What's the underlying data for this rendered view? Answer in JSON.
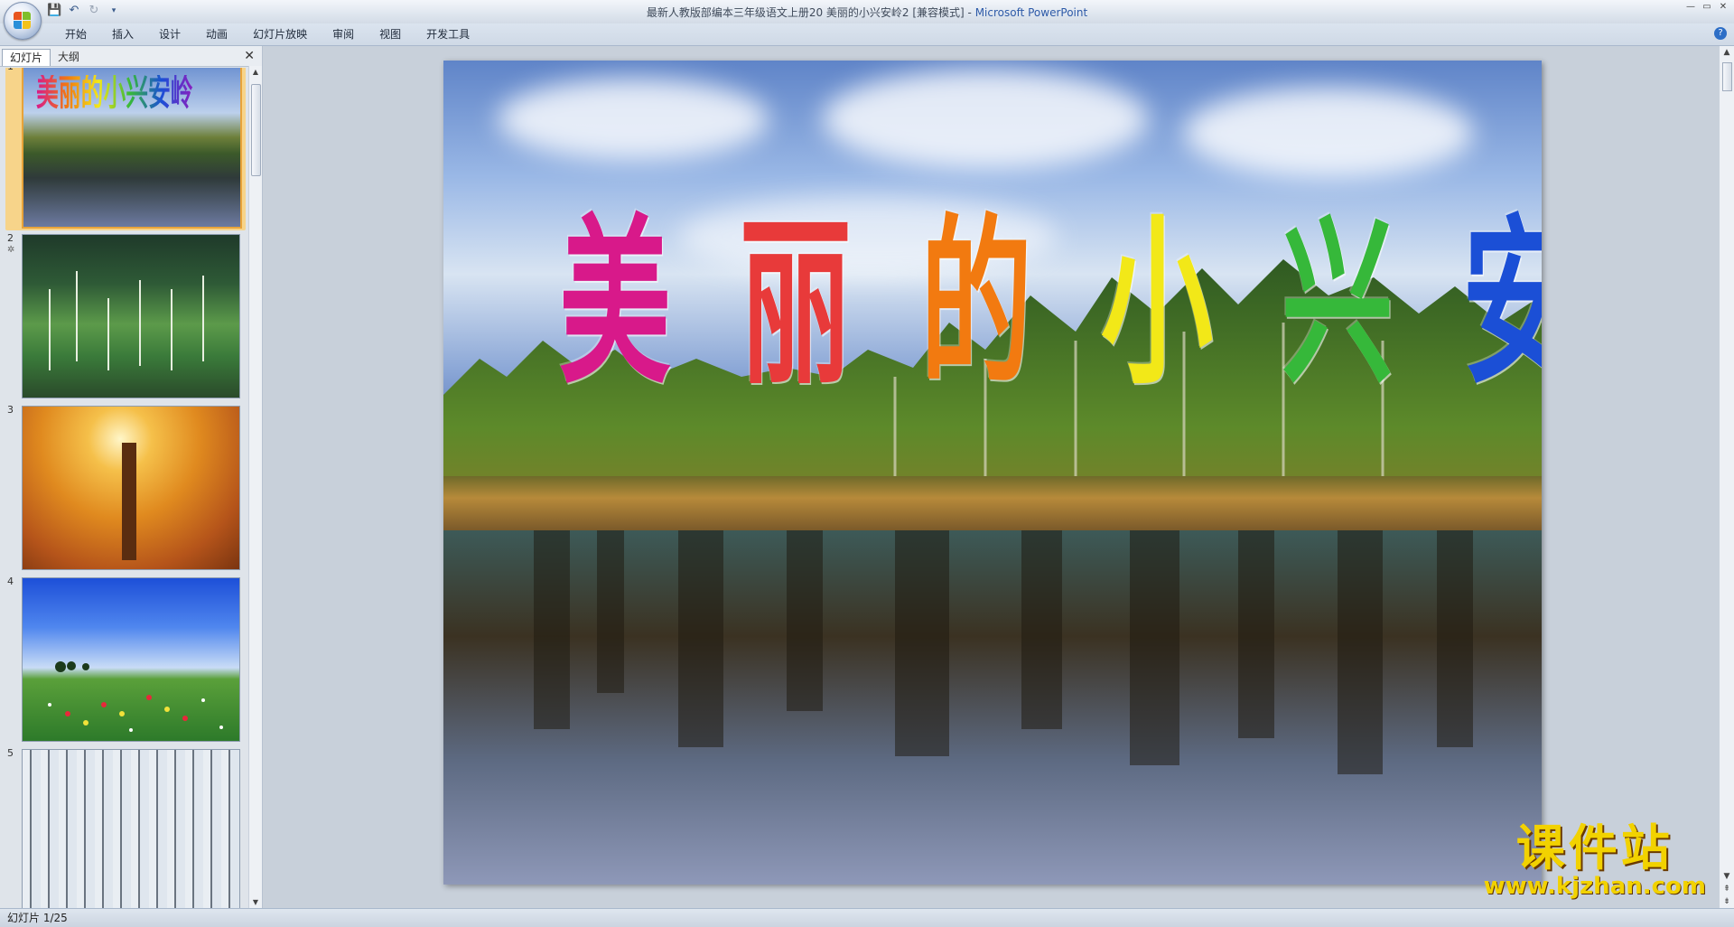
{
  "window": {
    "title": "最新人教版部编本三年级语文上册20 美丽的小兴安岭2 [兼容模式]",
    "separator": " - ",
    "app_name": "Microsoft PowerPoint",
    "controls": [
      "—",
      "▭",
      "✕"
    ]
  },
  "quick_access": {
    "save_icon": "save-icon",
    "undo_icon": "undo-icon",
    "redo_icon": "redo-icon",
    "customize_icon": "customize-icon"
  },
  "ribbon": {
    "tabs": [
      "开始",
      "插入",
      "设计",
      "动画",
      "幻灯片放映",
      "审阅",
      "视图",
      "开发工具"
    ],
    "help": "?"
  },
  "slide_panel": {
    "tabs": [
      "幻灯片",
      "大纲"
    ],
    "close": "✕",
    "thumbnails": [
      {
        "number": "1",
        "title": "美丽的小兴安岭"
      },
      {
        "number": "2",
        "mark": "✲"
      },
      {
        "number": "3"
      },
      {
        "number": "4"
      },
      {
        "number": "5"
      }
    ]
  },
  "slide": {
    "title_chars": [
      "美",
      "丽",
      "的",
      "小",
      "兴",
      "安",
      "岭"
    ],
    "title_colors": [
      "#d8198a",
      "#e83a3a",
      "#f27a10",
      "#f2e818",
      "#36b83a",
      "#1b4fd6",
      "#8a1fbf"
    ]
  },
  "watermark": {
    "brand": "课件站",
    "url": "www.kjzhan.com"
  },
  "status_bar": {
    "slide_indicator": "幻灯片 1/25"
  }
}
